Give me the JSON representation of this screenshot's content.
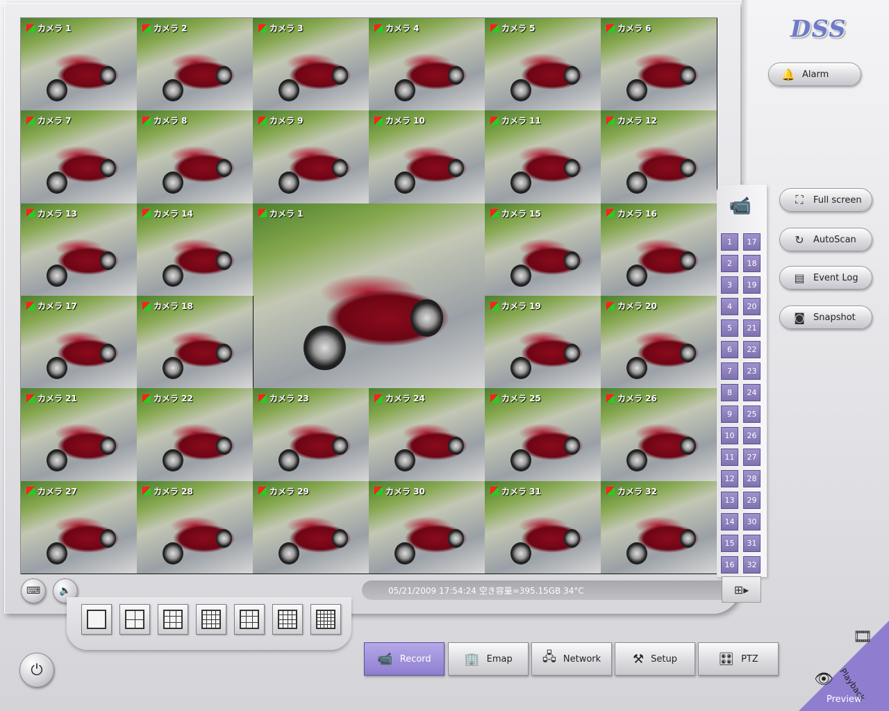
{
  "app": {
    "logo": "DSS"
  },
  "cameras": {
    "small": [
      "カメラ 1",
      "カメラ 2",
      "カメラ 3",
      "カメラ 4",
      "カメラ 5",
      "カメラ 6",
      "カメラ 7",
      "カメラ 8",
      "カメラ 9",
      "カメラ 10",
      "カメラ 11",
      "カメラ 12",
      "カメラ 13",
      "カメラ 14",
      "カメラ 15",
      "カメラ 16",
      "カメラ 17",
      "カメラ 18",
      "カメラ 19",
      "カメラ 20",
      "カメラ 21",
      "カメラ 22",
      "カメラ 23",
      "カメラ 24",
      "カメラ 25",
      "カメラ 26",
      "カメラ 27",
      "カメラ 28",
      "カメラ 29",
      "カメラ 30",
      "カメラ 31",
      "カメラ 32"
    ],
    "big": "カメラ 1"
  },
  "right_panel": {
    "alarm": "Alarm",
    "full_screen": "Full screen",
    "autoscan": "AutoScan",
    "event_log": "Event Log",
    "snapshot": "Snapshot"
  },
  "camera_numbers": {
    "left": [
      "1",
      "2",
      "3",
      "4",
      "5",
      "6",
      "7",
      "8",
      "9",
      "10",
      "11",
      "12",
      "13",
      "14",
      "15",
      "16"
    ],
    "right": [
      "17",
      "18",
      "19",
      "20",
      "21",
      "22",
      "23",
      "24",
      "25",
      "26",
      "27",
      "28",
      "29",
      "30",
      "31",
      "32"
    ]
  },
  "status": {
    "text": "05/21/2009 17:54:24  空き容量=395.15GB 34°C"
  },
  "tabs": {
    "record": "Record",
    "emap": "Emap",
    "network": "Network",
    "setup": "Setup",
    "ptz": "PTZ"
  },
  "modes": {
    "playback": "Playback",
    "preview": "Preview"
  },
  "layouts": [
    1,
    4,
    9,
    16,
    6,
    8,
    13
  ],
  "colors": {
    "accent": "#8f7ed0",
    "cam_button": "#8a7dbf"
  }
}
